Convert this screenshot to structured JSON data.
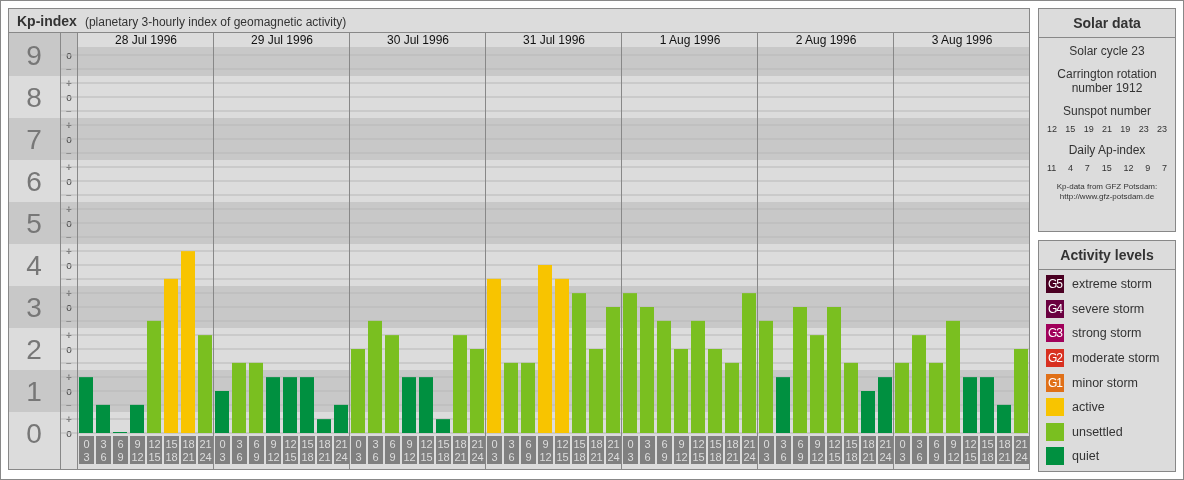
{
  "kp_panel": {
    "title": "Kp-index",
    "subtitle": "(planetary 3-hourly index of geomagnetic activity)",
    "days": [
      "28 Jul 1996",
      "29 Jul 1996",
      "30 Jul 1996",
      "31 Jul 1996",
      "1 Aug 1996",
      "2 Aug 1996",
      "3 Aug 1996"
    ],
    "scale_marks": [
      "o",
      "−",
      "+",
      "o",
      "−",
      "+",
      "o",
      "−",
      "+",
      "o",
      "−",
      "+",
      "o",
      "−",
      "+",
      "o",
      "−",
      "+",
      "o",
      "−",
      "+",
      "o",
      "−",
      "+",
      "o",
      "−",
      "+",
      "o"
    ],
    "chart_data": {
      "type": "bar",
      "ylim": [
        0,
        9
      ],
      "grid": true,
      "yticks": [
        {
          "value": 9,
          "label": "9"
        },
        {
          "value": 8,
          "label": "8"
        },
        {
          "value": 7,
          "label": "7"
        },
        {
          "value": 6,
          "label": "6"
        },
        {
          "value": 5,
          "label": "5"
        },
        {
          "value": 4,
          "label": "4"
        },
        {
          "value": 3,
          "label": "3"
        },
        {
          "value": 2,
          "label": "2"
        },
        {
          "value": 1,
          "label": "1"
        },
        {
          "value": 0,
          "label": "0"
        }
      ],
      "categories": [
        "0\n3",
        "3\n6",
        "6\n9",
        "9\n12",
        "12\n15",
        "15\n18",
        "18\n21",
        "21\n24",
        "0\n3",
        "3\n6",
        "6\n9",
        "9\n12",
        "12\n15",
        "15\n18",
        "18\n21",
        "21\n24",
        "0\n3",
        "3\n6",
        "6\n9",
        "9\n12",
        "12\n15",
        "15\n18",
        "18\n21",
        "21\n24",
        "0\n3",
        "3\n6",
        "6\n9",
        "9\n12",
        "12\n15",
        "15\n18",
        "18\n21",
        "21\n24",
        "0\n3",
        "3\n6",
        "6\n9",
        "9\n12",
        "12\n15",
        "15\n18",
        "18\n21",
        "21\n24",
        "0\n3",
        "3\n6",
        "6\n9",
        "9\n12",
        "12\n15",
        "15\n18",
        "18\n21",
        "21\n24",
        "0\n3",
        "3\n6",
        "6\n9",
        "9\n12",
        "12\n15",
        "15\n18",
        "18\n21",
        "21\n24"
      ],
      "series": [
        {
          "color": "#009040",
          "values": [
            1.33,
            0.67,
            0,
            0.67,
            null,
            null,
            null,
            null,
            1,
            null,
            null,
            1.33,
            1.33,
            1.33,
            0.33,
            0.67,
            null,
            null,
            null,
            1.33,
            1.33,
            0.33,
            null,
            null,
            null,
            null,
            null,
            null,
            null,
            null,
            null,
            null,
            null,
            null,
            null,
            null,
            null,
            null,
            null,
            null,
            null,
            1.33,
            null,
            null,
            null,
            null,
            1,
            1.33,
            null,
            null,
            null,
            null,
            1.33,
            1.33,
            0.67,
            null
          ]
        },
        {
          "color": "#7abf20",
          "values": [
            null,
            null,
            null,
            null,
            2.67,
            null,
            null,
            2.33,
            null,
            1.67,
            1.67,
            null,
            null,
            null,
            null,
            null,
            2,
            2.67,
            2.33,
            null,
            null,
            null,
            2.33,
            2,
            null,
            1.67,
            1.67,
            null,
            null,
            3.33,
            2,
            3,
            3.33,
            3,
            2.67,
            2,
            2.67,
            2,
            1.67,
            3.33,
            2.67,
            null,
            3,
            2.33,
            3,
            1.67,
            null,
            null,
            1.67,
            2.33,
            1.67,
            2.67,
            null,
            null,
            null,
            2
          ]
        },
        {
          "color": "#f8c400",
          "values": [
            null,
            null,
            null,
            null,
            null,
            3.67,
            4.33,
            null,
            null,
            null,
            null,
            null,
            null,
            null,
            null,
            null,
            null,
            null,
            null,
            null,
            null,
            null,
            null,
            null,
            3.67,
            null,
            null,
            4,
            3.67,
            null,
            null,
            null,
            null,
            null,
            null,
            null,
            null,
            null,
            null,
            null,
            null,
            null,
            null,
            null,
            null,
            null,
            null,
            null,
            null,
            null,
            null,
            null,
            null,
            null,
            null,
            null
          ]
        }
      ]
    }
  },
  "solar_data": {
    "title": "Solar data",
    "solar_cycle": "Solar cycle 23",
    "carrington_rotation": "Carrington rotation number 1912",
    "sunspot": {
      "label": "Sunspot number",
      "values": [
        "12",
        "15",
        "19",
        "21",
        "19",
        "23",
        "23"
      ]
    },
    "daily_ap": {
      "label": "Daily Ap-index",
      "values": [
        "11",
        "4",
        "7",
        "15",
        "12",
        "9",
        "7"
      ]
    },
    "source": {
      "text": "Kp-data from GFZ Potsdam:",
      "url": "http://www.gfz-potsdam.de"
    }
  },
  "activity_levels": {
    "title": "Activity levels",
    "items": [
      {
        "badge": "G5",
        "label": "extreme storm",
        "color": "#4a0022"
      },
      {
        "badge": "G4",
        "label": "severe storm",
        "color": "#6a0040"
      },
      {
        "badge": "G3",
        "label": "strong storm",
        "color": "#a0005a"
      },
      {
        "badge": "G2",
        "label": "moderate storm",
        "color": "#d83020"
      },
      {
        "badge": "G1",
        "label": "minor storm",
        "color": "#e07018"
      },
      {
        "label": "active",
        "color": "#f8c400"
      },
      {
        "label": "unsettled",
        "color": "#7abf20"
      },
      {
        "label": "quiet",
        "color": "#009040"
      }
    ]
  }
}
